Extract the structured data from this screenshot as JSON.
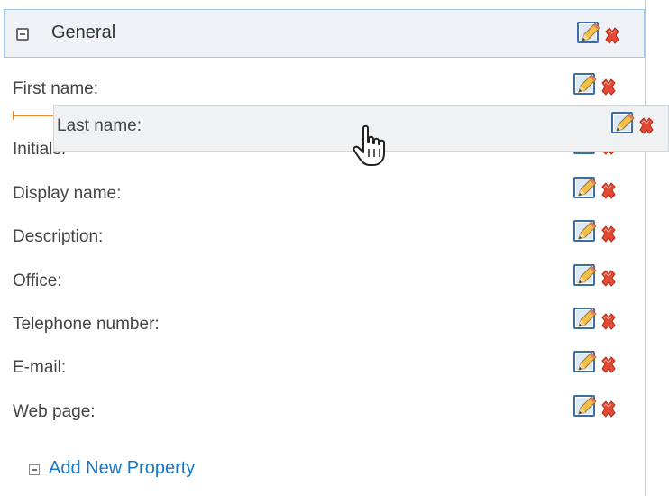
{
  "group": {
    "title": "General"
  },
  "properties": [
    {
      "label": "First name:"
    },
    {
      "label": "Initials:"
    },
    {
      "label": "Display name:"
    },
    {
      "label": "Description:"
    },
    {
      "label": "Office:"
    },
    {
      "label": "Telephone number:"
    },
    {
      "label": "E-mail:"
    },
    {
      "label": "Web page:"
    }
  ],
  "dragging": {
    "label": "Last name:"
  },
  "add_property": {
    "label": "Add New Property"
  },
  "icons": {
    "edit": "pencil-edit-icon",
    "delete": "red-x-delete-icon",
    "collapse": "collapse-minus-icon",
    "cursor": "hand-pointer-icon"
  },
  "colors": {
    "link": "#1878c8",
    "delete": "#e0402a",
    "header_border": "#a6c8e8",
    "drop_marker": "#f08a30"
  }
}
